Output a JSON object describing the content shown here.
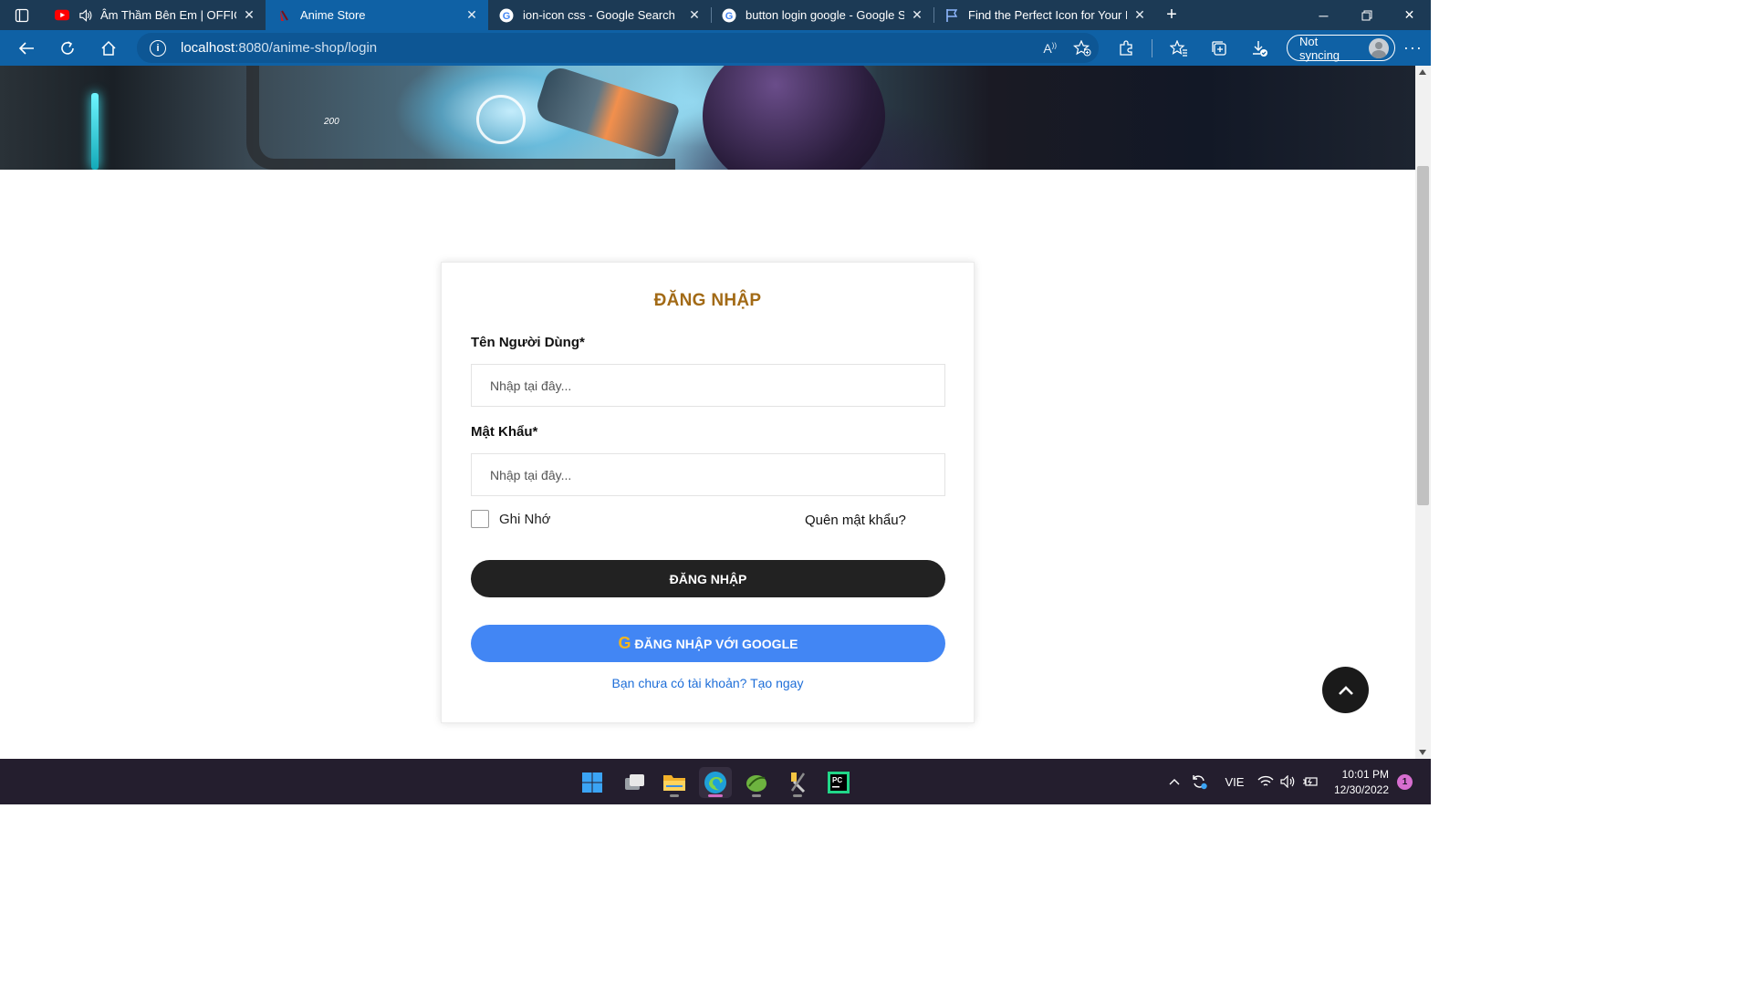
{
  "browser": {
    "tabs": [
      {
        "title": "Âm Thầm Bên Em | OFFICIAL",
        "favicon": "youtube-icon",
        "audio": true
      },
      {
        "title": "Anime Store",
        "favicon": "anime-store-icon",
        "active": true
      },
      {
        "title": "ion-icon css - Google Search",
        "favicon": "google-icon"
      },
      {
        "title": "button login google - Google Search",
        "favicon": "google-icon"
      },
      {
        "title": "Find the Perfect Icon for Your Project",
        "favicon": "flag-icon"
      }
    ],
    "url_host": "localhost",
    "url_path": ":8080/anime-shop/login",
    "sync_label": "Not syncing",
    "accent": "#0f61a5",
    "tabstrip_color": "#1c3a55"
  },
  "page": {
    "title": "ĐĂNG NHẬP",
    "username_label": "Tên Người Dùng*",
    "username_placeholder": "Nhập tại đây...",
    "password_label": "Mật Khẩu*",
    "password_placeholder": "Nhập tại đây...",
    "remember_label": "Ghi Nhớ",
    "forgot_label": "Quên mật khẩu?",
    "login_button": "ĐĂNG NHẬP",
    "google_icon_glyph": "G",
    "google_button": "ĐĂNG NHẬP VỚI GOOGLE",
    "signup_link": "Bạn chưa có tài khoản? Tạo ngay",
    "hero_hud_text": "200",
    "colors": {
      "title": "#a26a16",
      "login_button": "#222222",
      "google_button": "#4286f4",
      "link": "#1e6ed8"
    }
  },
  "taskbar": {
    "apps": [
      "windows-start-icon",
      "task-view-icon",
      "file-explorer-icon",
      "edge-icon",
      "spring-tool-icon",
      "tools-icon",
      "pycharm-icon"
    ],
    "language": "VIE",
    "time": "10:01 PM",
    "date": "12/30/2022",
    "notification_count": "1"
  }
}
